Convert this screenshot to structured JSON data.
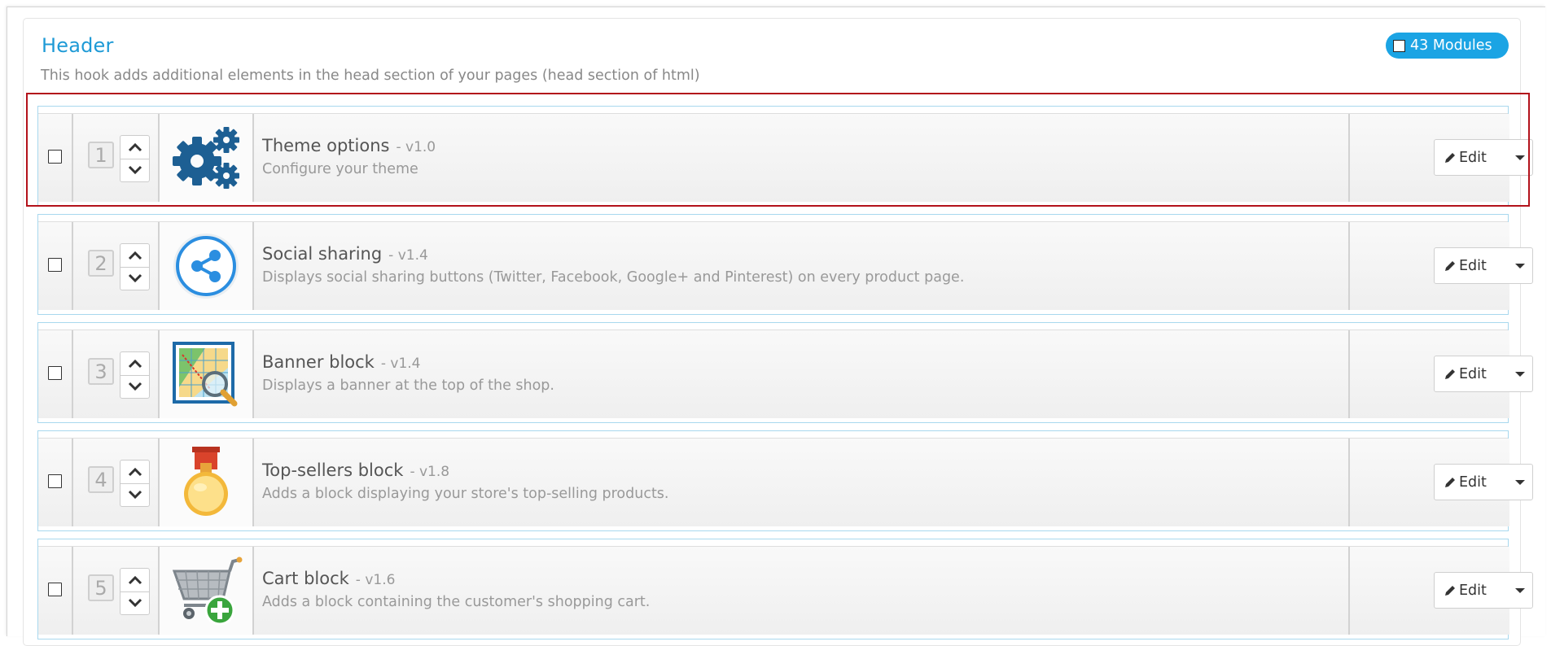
{
  "hook": {
    "title": "Header",
    "description": "This hook adds additional elements in the head section of your pages (head section of html)",
    "module_count": "43 Modules"
  },
  "edit_label": "Edit",
  "modules": [
    {
      "position": "1",
      "name": "Theme options",
      "version": "- v1.0",
      "description": "Configure your theme",
      "icon": "gears-icon"
    },
    {
      "position": "2",
      "name": "Social sharing",
      "version": "- v1.4",
      "description": "Displays social sharing buttons (Twitter, Facebook, Google+ and Pinterest) on every product page.",
      "icon": "share-icon"
    },
    {
      "position": "3",
      "name": "Banner block",
      "version": "- v1.4",
      "description": "Displays a banner at the top of the shop.",
      "icon": "banner-magnifier-icon"
    },
    {
      "position": "4",
      "name": "Top-sellers block",
      "version": "- v1.8",
      "description": "Adds a block displaying your store's top-selling products.",
      "icon": "medal-icon"
    },
    {
      "position": "5",
      "name": "Cart block",
      "version": "- v1.6",
      "description": "Adds a block containing the customer's shopping cart.",
      "icon": "cart-add-icon"
    }
  ],
  "colors": {
    "accent": "#1ba4e4",
    "title": "#1e9ad6",
    "highlight": "#b3121b",
    "row_border": "#a8d8ee"
  }
}
